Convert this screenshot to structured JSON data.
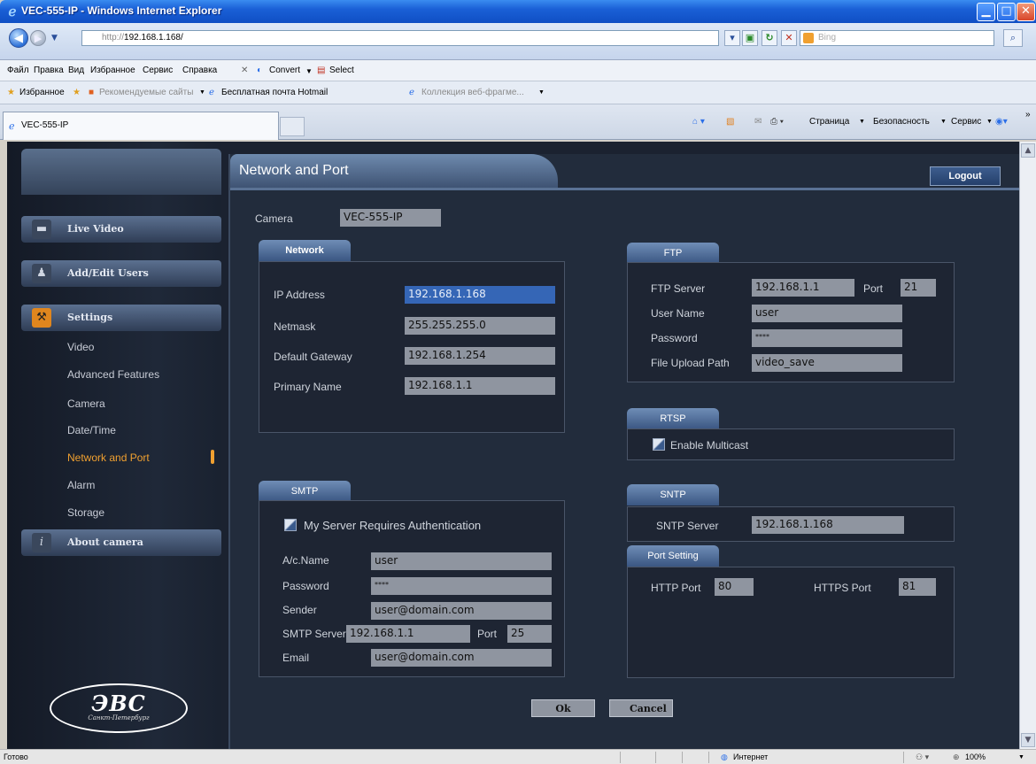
{
  "window": {
    "title": "VEC-555-IP - Windows Internet Explorer",
    "min_glyph": "▁",
    "max_glyph": "□",
    "close_glyph": "✕"
  },
  "address": {
    "url_proto": "http://",
    "url_host": "192.168.1.168/",
    "search_placeholder": "Bing"
  },
  "menu": {
    "items": [
      "Файл",
      "Правка",
      "Вид",
      "Избранное",
      "Сервис",
      "Справка"
    ],
    "convert": "Convert",
    "select": "Select"
  },
  "favorites": {
    "label": "Избранное",
    "items": [
      "Рекомендуемые сайты",
      "Бесплатная почта Hotmail",
      "Коллекция веб-фрагме..."
    ]
  },
  "tabs": {
    "active": "VEC-555-IP",
    "commands": [
      "Страница",
      "Безопасность",
      "Сервис"
    ]
  },
  "sidebar": {
    "buttons": [
      {
        "label": "Live Video",
        "icon": "video-camera-icon"
      },
      {
        "label": "Add/Edit Users",
        "icon": "user-add-icon"
      },
      {
        "label": "Settings",
        "icon": "settings-icon"
      },
      {
        "label": "About camera",
        "icon": "info-icon"
      }
    ],
    "settings_items": [
      "Video",
      "Advanced Features",
      "Camera",
      "Date/Time",
      "Network and Port",
      "Alarm",
      "Storage"
    ],
    "active_item": "Network and Port",
    "logo_text": "ЭВС",
    "logo_sub": "Санкт-Петербург"
  },
  "page": {
    "title": "Network and Port",
    "logout": "Logout",
    "camera_label": "Camera",
    "camera_value": "VEC-555-IP",
    "ok": "Ok",
    "cancel": "Cancel"
  },
  "network": {
    "tab": "Network",
    "ip_label": "IP Address",
    "ip": "192.168.1.168",
    "netmask_label": "Netmask",
    "netmask": "255.255.255.0",
    "gateway_label": "Default Gateway",
    "gateway": "192.168.1.254",
    "dns_label": "Primary Name",
    "dns": "192.168.1.1"
  },
  "smtp": {
    "tab": "SMTP",
    "auth_label": "My Server Requires Authentication",
    "name_label": "A/c.Name",
    "name": "user",
    "password_label": "Password",
    "password": "****",
    "sender_label": "Sender",
    "sender": "user@domain.com",
    "server_label": "SMTP Server",
    "server": "192.168.1.1",
    "port_label": "Port",
    "port": "25",
    "email_label": "Email",
    "email": "user@domain.com"
  },
  "ftp": {
    "tab": "FTP",
    "server_label": "FTP Server",
    "server": "192.168.1.1",
    "port_label": "Port",
    "port": "21",
    "user_label": "User Name",
    "user": "user",
    "password_label": "Password",
    "password": "****",
    "path_label": "File Upload Path",
    "path": "video_save"
  },
  "rtsp": {
    "tab": "RTSP",
    "multicast_label": "Enable Multicast"
  },
  "sntp": {
    "tab": "SNTP",
    "server_label": "SNTP Server",
    "server": "192.168.1.168"
  },
  "ports": {
    "tab": "Port Setting",
    "http_label": "HTTP Port",
    "http": "80",
    "https_label": "HTTPS Port",
    "https": "81"
  },
  "status": {
    "left": "Готово",
    "zone": "Интернет",
    "zoom": "100%"
  }
}
